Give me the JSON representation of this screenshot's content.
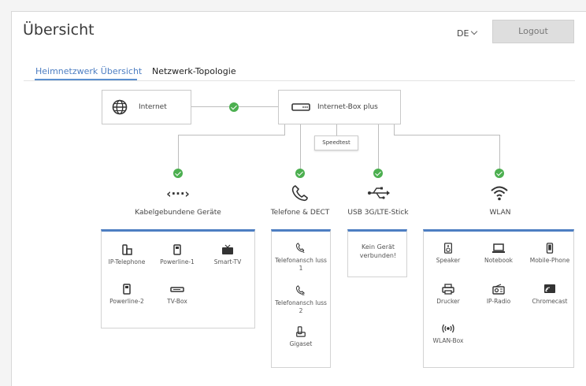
{
  "header": {
    "title": "Übersicht",
    "language": "DE",
    "logout_label": "Logout"
  },
  "tabs": [
    {
      "label": "Heimnetzwerk Übersicht",
      "active": true
    },
    {
      "label": "Netzwerk-Topologie",
      "active": false
    }
  ],
  "topology": {
    "internet_label": "Internet",
    "box_label": "Internet-Box plus",
    "speedtest_label": "Speedtest",
    "status_color": "#4caf50",
    "accent_color": "#4d7ec2"
  },
  "categories": {
    "wired": {
      "label": "Kabelgebundene Geräte",
      "devices": [
        {
          "label": "IP-Telephone",
          "icon": "ip-phone-icon"
        },
        {
          "label": "Powerline-1",
          "icon": "powerline-icon"
        },
        {
          "label": "Smart-TV",
          "icon": "tv-icon"
        },
        {
          "label": "Powerline-2",
          "icon": "powerline-icon"
        },
        {
          "label": "TV-Box",
          "icon": "tv-box-icon"
        }
      ]
    },
    "phone": {
      "label": "Telefone & DECT",
      "devices": [
        {
          "label": "Telefonansch luss 1",
          "icon": "phone-1-icon"
        },
        {
          "label": "Telefonansch luss 2",
          "icon": "phone-2-icon"
        },
        {
          "label": "Gigaset",
          "icon": "dect-phone-icon"
        }
      ]
    },
    "usb": {
      "label": "USB 3G/LTE-Stick",
      "empty_label": "Kein Gerät verbunden!"
    },
    "wlan": {
      "label": "WLAN",
      "devices": [
        {
          "label": "Speaker",
          "icon": "speaker-icon"
        },
        {
          "label": "Notebook",
          "icon": "laptop-icon"
        },
        {
          "label": "Mobile-Phone",
          "icon": "mobile-icon"
        },
        {
          "label": "Drucker",
          "icon": "printer-icon"
        },
        {
          "label": "IP-Radio",
          "icon": "radio-icon"
        },
        {
          "label": "Chromecast",
          "icon": "cast-icon"
        },
        {
          "label": "WLAN-Box",
          "icon": "wlan-box-icon"
        }
      ]
    }
  }
}
